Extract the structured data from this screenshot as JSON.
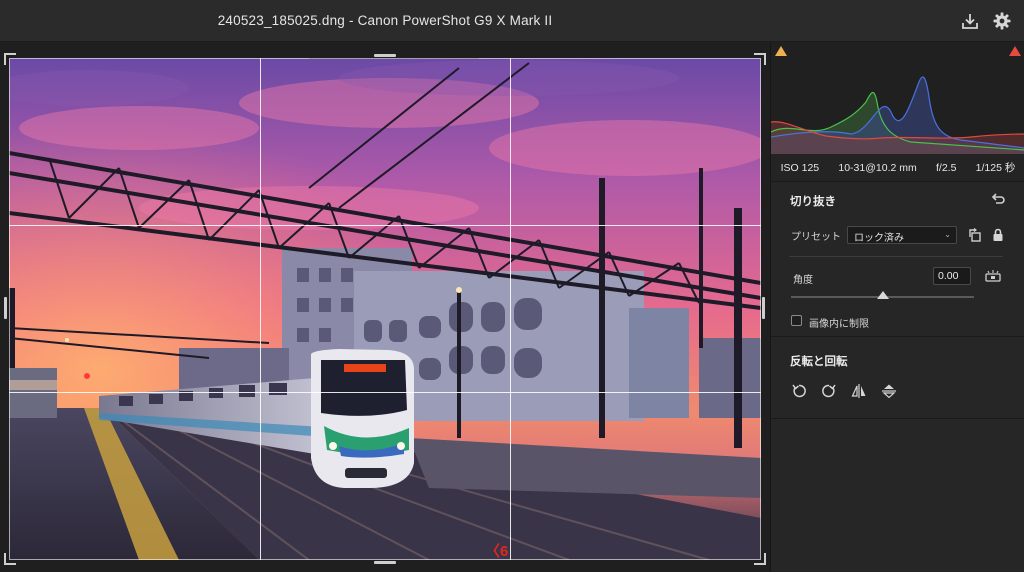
{
  "window": {
    "title": "240523_185025.dng  -  Canon PowerShot G9 X Mark II",
    "buttons": {
      "save": "download-tray-icon",
      "settings": "gear-icon"
    }
  },
  "histogram": {
    "shadow_clip_color": "#f0b050",
    "highlight_clip_color": "#e84a40",
    "exif": {
      "iso": "ISO 125",
      "focal": "10-31@10.2 mm",
      "aperture": "f/2.5",
      "shutter": "1/125 秒"
    }
  },
  "crop": {
    "title": "切り抜き",
    "reset_icon": "undo-arrow-icon",
    "preset_label": "プリセット",
    "preset_value": "ロック済み",
    "rotate_aspect_icon": "rotate-aspect-icon",
    "lock_icon": "lock-icon",
    "angle_label": "角度",
    "angle_value": "0.00",
    "angle_level": 0.5,
    "straighten_icon": "straighten-level-icon",
    "constrain_label": "画像内に制限",
    "constrain_checked": false
  },
  "transform": {
    "title": "反転と回転",
    "buttons": [
      "rotate-left-icon",
      "rotate-right-icon",
      "flip-horizontal-icon",
      "flip-vertical-icon"
    ]
  },
  "photo": {
    "angle_marker": "〈6"
  },
  "colors": {
    "accent": "#e3261f",
    "panel": "#262626",
    "canvas": "#1f1f1f"
  }
}
